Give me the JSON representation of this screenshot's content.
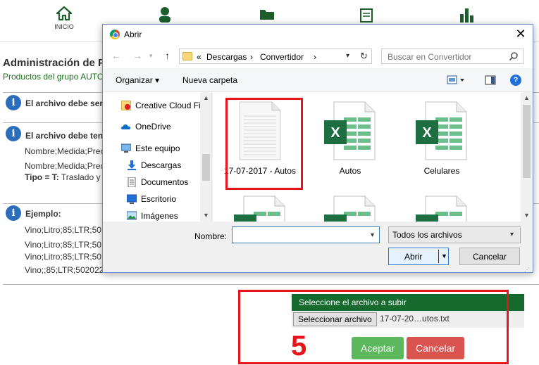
{
  "app": {
    "nav": [
      {
        "label": "INICIO",
        "icon": "home-icon"
      },
      {
        "label": "",
        "icon": "user-icon"
      },
      {
        "label": "",
        "icon": "folder-icon"
      },
      {
        "label": "",
        "icon": "document-icon"
      },
      {
        "label": "",
        "icon": "bar-chart-icon"
      }
    ],
    "title": "Administración de P",
    "subtitle": "Productos del grupo AUTO",
    "info1": "El archivo debe ser",
    "info2_title": "El archivo debe ten",
    "info2_line1": "Nombre;Medida;Prec",
    "info2_line2": "Nombre;Medida;Prec",
    "info2_tipo_label": "Tipo = T:",
    "info2_tipo_text": " Traslado y",
    "example_title": "Ejemplo:",
    "example_lines": [
      "Vino;Litro;85;LTR;50",
      "Vino;Litro;85;LTR;50",
      "Vino;Litro;85;LTR;50",
      "Vino;;85;LTR;502022"
    ],
    "upload": {
      "header": "Seleccione el archivo a subir",
      "select_button": "Seleccionar archivo",
      "file_name": "17-07-20…utos.txt",
      "accept": "Aceptar",
      "cancel": "Cancelar"
    },
    "step_number": "5"
  },
  "dialog": {
    "title": "Abrir",
    "breadcrumb": [
      "«",
      "Descargas",
      "›",
      "Convertidor",
      "›"
    ],
    "search_placeholder": "Buscar en Convertidor",
    "organize": "Organizar ▾",
    "new_folder": "Nueva carpeta",
    "nav_items": [
      {
        "label": "Creative Cloud Fil",
        "icon": "creative-cloud-icon"
      },
      {
        "label": "OneDrive",
        "icon": "onedrive-icon"
      },
      {
        "label": "Este equipo",
        "icon": "computer-icon"
      },
      {
        "label": "Descargas",
        "icon": "download-icon"
      },
      {
        "label": "Documentos",
        "icon": "documents-icon"
      },
      {
        "label": "Escritorio",
        "icon": "desktop-icon"
      },
      {
        "label": "Imágenes",
        "icon": "images-icon"
      }
    ],
    "files": [
      {
        "label": "17-07-2017 - Autos",
        "type": "text"
      },
      {
        "label": "Autos",
        "type": "excel"
      },
      {
        "label": "Celulares",
        "type": "excel"
      },
      {
        "label": "",
        "type": "excel"
      },
      {
        "label": "",
        "type": "excel"
      },
      {
        "label": "",
        "type": "excel"
      }
    ],
    "name_label": "Nombre:",
    "name_value": "",
    "file_type": "Todos los archivos",
    "open_button": "Abrir",
    "cancel_button": "Cancelar"
  },
  "colors": {
    "brand_green": "#166a2e",
    "accept_green": "#5cb85c",
    "cancel_red": "#d9534f",
    "highlight_red": "#e8141c",
    "info_blue": "#2a6ebb",
    "excel_green": "#1d6f42"
  }
}
